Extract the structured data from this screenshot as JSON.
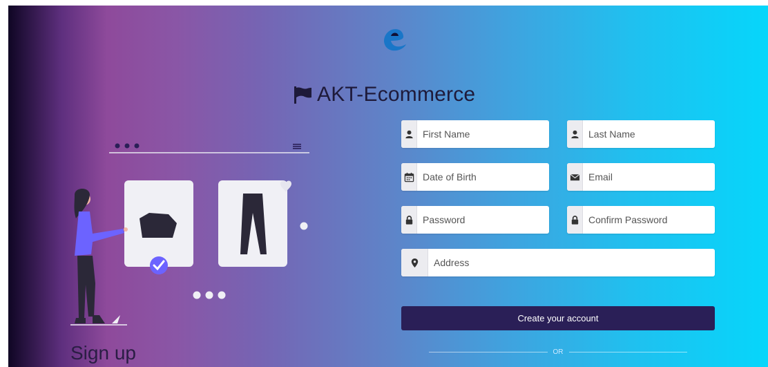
{
  "brand": {
    "name": "AKT-Ecommerce"
  },
  "heading": "Sign up",
  "form": {
    "first_name_placeholder": "First Name",
    "last_name_placeholder": "Last Name",
    "dob_placeholder": "Date of Birth",
    "email_placeholder": "Email",
    "password_placeholder": "Password",
    "confirm_password_placeholder": "Confirm Password",
    "address_placeholder": "Address",
    "submit_label": "Create your account",
    "divider_text": "OR"
  },
  "icons": {
    "first_name": "user-icon",
    "last_name": "user-icon",
    "dob": "calendar-icon",
    "email": "envelope-icon",
    "password": "lock-icon",
    "confirm_password": "lock-icon",
    "address": "map-marker-icon",
    "brand": "flag-icon"
  },
  "colors": {
    "button_bg": "#2a1f57",
    "logo_blue": "#1976c8",
    "accent_purple": "#6c63ff",
    "gradient_left": "#8e4a9b",
    "gradient_right": "#06d6fb"
  }
}
